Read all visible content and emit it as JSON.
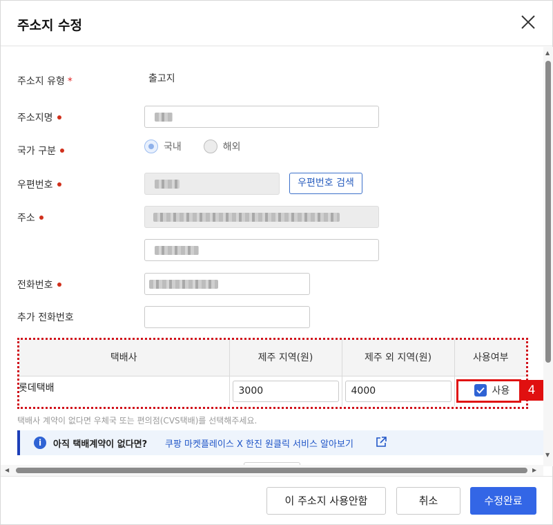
{
  "dialog": {
    "title": "주소지 수정"
  },
  "fields": {
    "address_type": {
      "label": "주소지 유형",
      "required_mark": "*",
      "value": "출고지"
    },
    "address_name": {
      "label": "주소지명"
    },
    "country": {
      "label": "국가 구분",
      "options": [
        "국내",
        "해외"
      ],
      "selected": "국내"
    },
    "postal_code": {
      "label": "우편번호",
      "search_button": "우편번호 검색"
    },
    "address": {
      "label": "주소"
    },
    "phone": {
      "label": "전화번호"
    },
    "extra_phone": {
      "label": "추가 전화번호",
      "value": ""
    }
  },
  "courier_table": {
    "headers": [
      "택배사",
      "제주 지역(원)",
      "제주 외 지역(원)",
      "사용여부"
    ],
    "rows": [
      {
        "courier": "롯데택배",
        "jeju_fee": "3000",
        "non_jeju_fee": "4000",
        "use_label": "사용",
        "use_checked": true
      }
    ]
  },
  "annotation": {
    "badge": "4",
    "color": "#e01010"
  },
  "hint": "택배사 계약이 없다면 우체국 또는 편의점(CVS택배)를 선택해주세요.",
  "info_banner": {
    "question": "아직 택배계약이 없다면?",
    "link": "쿠팡 마켓플레이스 X 한진 원클릭 서비스 알아보기"
  },
  "footer": {
    "disable_button": "이 주소지 사용안함",
    "cancel_button": "취소",
    "submit_button": "수정완료"
  },
  "colors": {
    "primary": "#3366e6",
    "required": "#d0301c",
    "link": "#1f55c7"
  }
}
